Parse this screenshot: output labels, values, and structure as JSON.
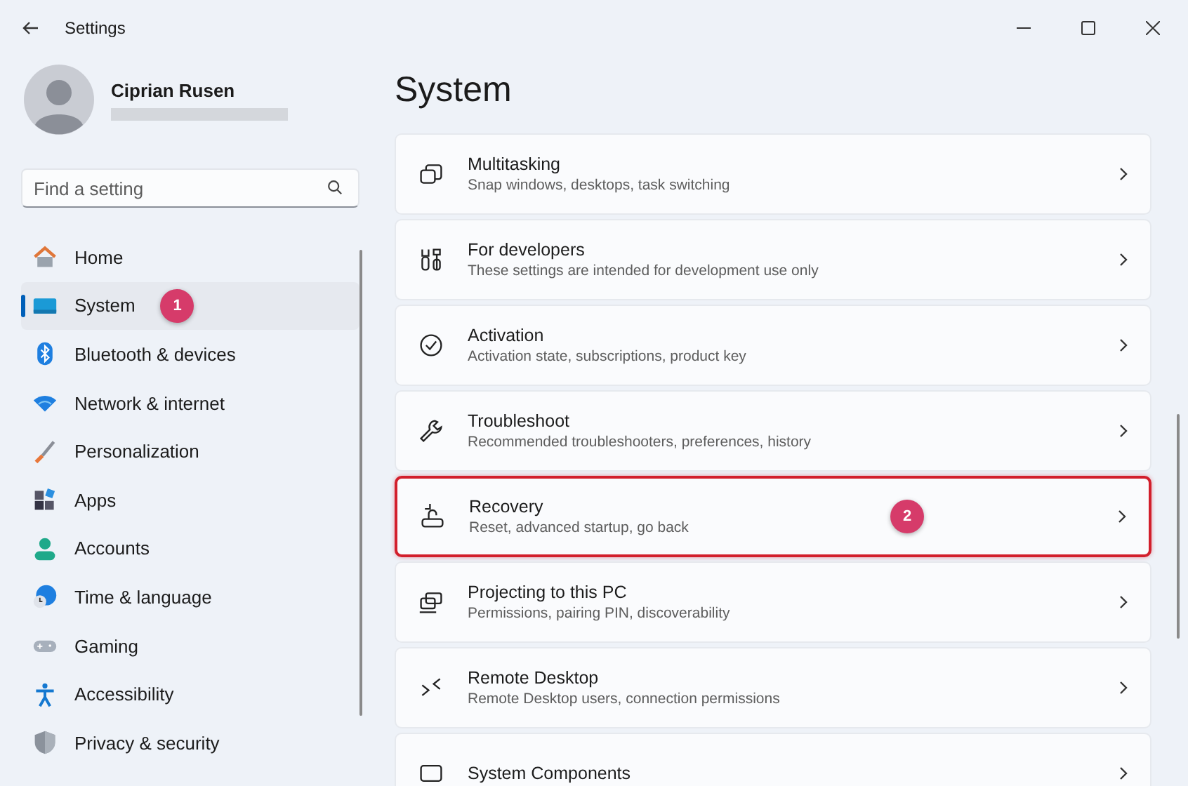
{
  "window": {
    "title": "Settings"
  },
  "account": {
    "name": "Ciprian Rusen",
    "email_redacted": true
  },
  "search": {
    "placeholder": "Find a setting"
  },
  "sidebar": {
    "items": [
      {
        "label": "Home",
        "kind": "home",
        "selected": false
      },
      {
        "label": "System",
        "kind": "system",
        "selected": true,
        "annotation": "1"
      },
      {
        "label": "Bluetooth & devices",
        "kind": "bluetooth",
        "selected": false
      },
      {
        "label": "Network & internet",
        "kind": "wifi",
        "selected": false
      },
      {
        "label": "Personalization",
        "kind": "brush",
        "selected": false
      },
      {
        "label": "Apps",
        "kind": "apps",
        "selected": false
      },
      {
        "label": "Accounts",
        "kind": "person",
        "selected": false
      },
      {
        "label": "Time & language",
        "kind": "globe",
        "selected": false
      },
      {
        "label": "Gaming",
        "kind": "gamepad",
        "selected": false
      },
      {
        "label": "Accessibility",
        "kind": "accessibility",
        "selected": false
      },
      {
        "label": "Privacy & security",
        "kind": "shield",
        "selected": false
      }
    ]
  },
  "page": {
    "title": "System"
  },
  "cards": [
    {
      "title": "Multitasking",
      "subtitle": "Snap windows, desktops, task switching",
      "kind": "windows",
      "highlighted": false
    },
    {
      "title": "For developers",
      "subtitle": "These settings are intended for development use only",
      "kind": "tools",
      "highlighted": false
    },
    {
      "title": "Activation",
      "subtitle": "Activation state, subscriptions, product key",
      "kind": "check",
      "highlighted": false
    },
    {
      "title": "Troubleshoot",
      "subtitle": "Recommended troubleshooters, preferences, history",
      "kind": "wrench",
      "highlighted": false
    },
    {
      "title": "Recovery",
      "subtitle": "Reset, advanced startup, go back",
      "kind": "recovery",
      "highlighted": true,
      "annotation": "2"
    },
    {
      "title": "Projecting to this PC",
      "subtitle": "Permissions, pairing PIN, discoverability",
      "kind": "project",
      "highlighted": false
    },
    {
      "title": "Remote Desktop",
      "subtitle": "Remote Desktop users, connection permissions",
      "kind": "remote",
      "highlighted": false
    },
    {
      "title": "System Components",
      "kind": "components",
      "highlighted": false
    }
  ]
}
